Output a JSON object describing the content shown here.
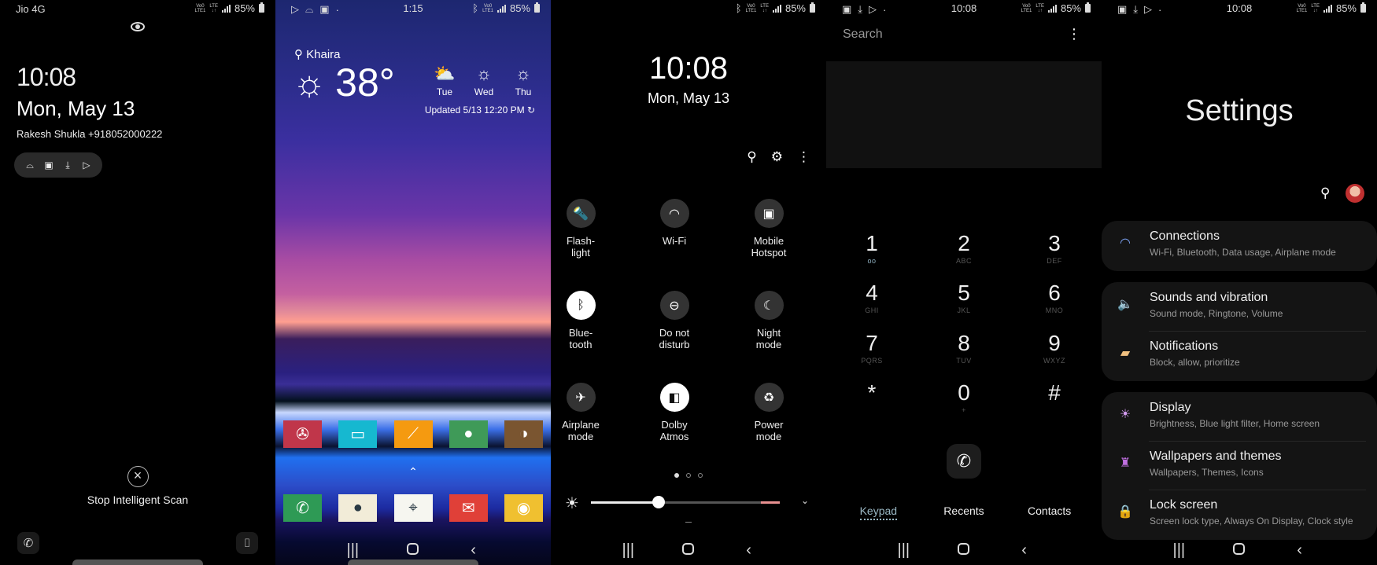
{
  "lock_screen": {
    "status": {
      "carrier": "Jio 4G",
      "network": [
        "VoLTE LTE1",
        "LTE"
      ],
      "battery": "85%"
    },
    "time": "10:08",
    "date": "Mon, May 13",
    "owner_info": "Rakesh Shukla +918052000222",
    "notification_icons": [
      "game-icon",
      "gallery-icon",
      "download-icon",
      "play-store-icon"
    ],
    "stop_scan_label": "Stop Intelligent Scan",
    "shortcuts": {
      "left": "phone",
      "right": "camera"
    }
  },
  "home_screen": {
    "status": {
      "time": "1:15",
      "battery": "85%",
      "left_icons": [
        "play-store-icon",
        "game-icon",
        "gallery-icon"
      ]
    },
    "weather": {
      "location": "Khaira",
      "temperature": "38°",
      "condition": "sunny",
      "forecast": [
        {
          "day": "Tue",
          "icon": "partly-cloudy"
        },
        {
          "day": "Wed",
          "icon": "sunny"
        },
        {
          "day": "Thu",
          "icon": "sunny"
        }
      ],
      "updated": "Updated 5/13 12:20 PM"
    },
    "apps_row": [
      {
        "name": "Mercedes",
        "color": "#c0364a",
        "glyph": "✇"
      },
      {
        "name": "Messages",
        "color": "#16b8d0",
        "glyph": "▭"
      },
      {
        "name": "Analytics",
        "color": "#f59a10",
        "glyph": "⟋"
      },
      {
        "name": "Chat",
        "color": "#3f9a58",
        "glyph": "●"
      },
      {
        "name": "AdSense",
        "color": "#7a5530",
        "glyph": "◑"
      }
    ],
    "dock": [
      {
        "name": "Phone",
        "color": "#2e9a55",
        "glyph": "✆"
      },
      {
        "name": "Camera",
        "color": "#f2ecd8",
        "glyph": "●"
      },
      {
        "name": "Maps",
        "color": "#f6f6f0",
        "glyph": "⌖"
      },
      {
        "name": "Email",
        "color": "#e04038",
        "glyph": "✉"
      },
      {
        "name": "Chrome",
        "color": "#f0c030",
        "glyph": "◉"
      }
    ]
  },
  "quick_panel": {
    "status": {
      "battery": "85%"
    },
    "time": "10:08",
    "date": "Mon, May 13",
    "tiles": [
      {
        "label": "Flash-\nlight",
        "icon": "flashlight-icon",
        "glyph": "🔦",
        "on": false
      },
      {
        "label": "Wi-Fi",
        "icon": "wifi-icon",
        "glyph": "◠",
        "on": false
      },
      {
        "label": "Mobile\nHotspot",
        "icon": "hotspot-icon",
        "glyph": "▣",
        "on": false
      },
      {
        "label": "Blue-\ntooth",
        "icon": "bluetooth-icon",
        "glyph": "ᛒ",
        "on": true
      },
      {
        "label": "Do not\ndisturb",
        "icon": "dnd-icon",
        "glyph": "⊖",
        "on": false
      },
      {
        "label": "Night\nmode",
        "icon": "moon-icon",
        "glyph": "☾",
        "on": false
      },
      {
        "label": "Airplane\nmode",
        "icon": "airplane-icon",
        "glyph": "✈",
        "on": false
      },
      {
        "label": "Dolby\nAtmos",
        "icon": "dolby-icon",
        "glyph": "◧",
        "on": true
      },
      {
        "label": "Power\nmode",
        "icon": "battery-icon",
        "glyph": "♻",
        "on": false
      }
    ],
    "page_count": 3,
    "active_page": 1,
    "brightness_percent": 36
  },
  "dialer": {
    "status": {
      "time": "10:08",
      "battery": "85%"
    },
    "search_placeholder": "Search",
    "keys": [
      {
        "digit": "1",
        "sub": "voicemail"
      },
      {
        "digit": "2",
        "sub": "ABC"
      },
      {
        "digit": "3",
        "sub": "DEF"
      },
      {
        "digit": "4",
        "sub": "GHI"
      },
      {
        "digit": "5",
        "sub": "JKL"
      },
      {
        "digit": "6",
        "sub": "MNO"
      },
      {
        "digit": "7",
        "sub": "PQRS"
      },
      {
        "digit": "8",
        "sub": "TUV"
      },
      {
        "digit": "9",
        "sub": "WXYZ"
      },
      {
        "digit": "*",
        "sub": ""
      },
      {
        "digit": "0",
        "sub": "+"
      },
      {
        "digit": "#",
        "sub": ""
      }
    ],
    "tabs": [
      {
        "label": "Keypad",
        "active": true
      },
      {
        "label": "Recents",
        "active": false
      },
      {
        "label": "Contacts",
        "active": false
      }
    ]
  },
  "settings": {
    "status": {
      "time": "10:08",
      "battery": "85%"
    },
    "title": "Settings",
    "groups": [
      [
        {
          "label": "Connections",
          "sub": "Wi-Fi, Bluetooth, Data usage, Airplane mode",
          "icon": "wifi-icon",
          "glyph": "◠",
          "color": "#7aa0f0"
        }
      ],
      [
        {
          "label": "Sounds and vibration",
          "sub": "Sound mode, Ringtone, Volume",
          "icon": "speaker-icon",
          "glyph": "🔈",
          "color": "#6cc0a0"
        },
        {
          "label": "Notifications",
          "sub": "Block, allow, prioritize",
          "icon": "notification-icon",
          "glyph": "▰",
          "color": "#f0c080"
        }
      ],
      [
        {
          "label": "Display",
          "sub": "Brightness, Blue light filter, Home screen",
          "icon": "sun-icon",
          "glyph": "☀",
          "color": "#d49cf0"
        },
        {
          "label": "Wallpapers and themes",
          "sub": "Wallpapers, Themes, Icons",
          "icon": "brush-icon",
          "glyph": "♜",
          "color": "#c070e0"
        },
        {
          "label": "Lock screen",
          "sub": "Screen lock type, Always On Display, Clock style",
          "icon": "lock-icon",
          "glyph": "🔒",
          "color": "#70c0a0"
        }
      ]
    ]
  }
}
